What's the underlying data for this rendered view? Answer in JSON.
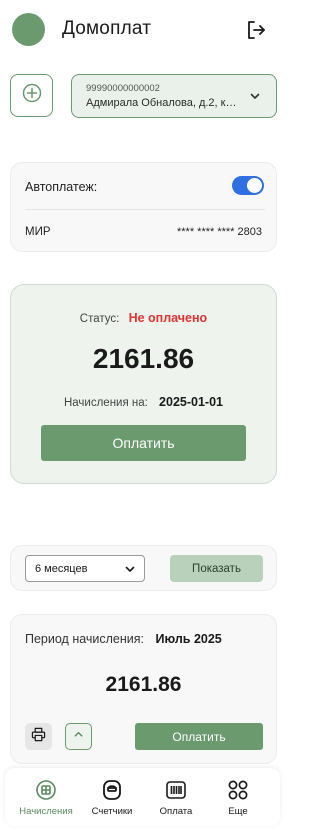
{
  "header": {
    "title": "Домоплат",
    "logout_icon": "logout-icon"
  },
  "account": {
    "number": "99990000000002",
    "address": "Адмирала Обналова, д.2, к…"
  },
  "autopay": {
    "label": "Автоплатеж:",
    "enabled": true,
    "card_brand": "МИР",
    "card_mask": "**** **** **** 2803"
  },
  "status_card": {
    "status_label": "Статус:",
    "status_value": "Не оплачено",
    "amount": "2161.86",
    "charges_label": "Начисления на:",
    "charges_date": "2025-01-01",
    "pay_label": "Оплатить"
  },
  "period_filter": {
    "selected": "6 месяцев",
    "show_label": "Показать"
  },
  "bill": {
    "period_label": "Период начисления:",
    "period_value": "Июль 2025",
    "amount": "2161.86",
    "pay_label": "Оплатить"
  },
  "tabbar": {
    "tabs": [
      {
        "label": "Начисления",
        "icon": "accruals-icon",
        "active": true
      },
      {
        "label": "Счетчики",
        "icon": "meters-icon",
        "active": false
      },
      {
        "label": "Оплата",
        "icon": "payment-icon",
        "active": false
      },
      {
        "label": "Еще",
        "icon": "more-icon",
        "active": false
      }
    ]
  },
  "colors": {
    "accent": "#6b9a6f",
    "status_unpaid": "#e03434",
    "toggle_on": "#2f6fe0"
  }
}
